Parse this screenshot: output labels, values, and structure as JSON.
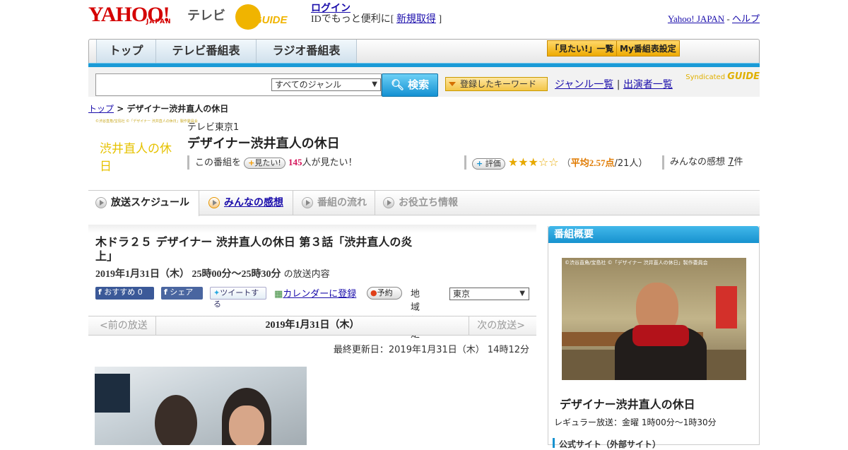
{
  "header": {
    "brand": "YAHOO!",
    "brand_sub": "JAPAN",
    "service": "テレビ",
    "gguide": "GUIDE",
    "login": "ログイン",
    "login_note": "IDでもっと便利に[",
    "signup": "新規取得",
    "login_note_end": "]",
    "yahoo_japan": "Yahoo! JAPAN",
    "sep": "-",
    "help": "ヘルプ"
  },
  "nav": {
    "tabs": [
      "トップ",
      "テレビ番組表",
      "ラジオ番組表"
    ],
    "watch_list": "「見たい!」一覧",
    "my_schedule": "My番組表設定"
  },
  "search": {
    "genre": "すべてのジャンル",
    "button": "検索",
    "keyword": "登録したキーワード",
    "genre_list": "ジャンル一覧",
    "divider": "|",
    "cast_list": "出演者一覧",
    "syndicated": "Syndicated"
  },
  "breadcrumb": {
    "top": "トップ",
    "sep": ">",
    "current": "デザイナー渋井直人の休日"
  },
  "program": {
    "thumb_small": "©渋谷直角/宝島社 ©「デザイナー 渋井直人の休日」製作委員会",
    "thumb_title": "渋井直人の休日",
    "channel": "テレビ東京1",
    "title": "デザイナー渋井直人の休日",
    "want_prefix": "この番組を",
    "want_button": "見たい!",
    "want_count": "145",
    "want_suffix": "人が見たい！",
    "rate_button": "評価",
    "stars": "★★★☆☆",
    "avg_open": "（",
    "avg": "平均2.57点",
    "avg_count": "/21人）",
    "review_label": "みんなの感想",
    "review_count": "7",
    "review_suffix": "件"
  },
  "subtabs": [
    "放送スケジュール",
    "みんなの感想",
    "番組の流れ",
    "お役立ち情報"
  ],
  "episode": {
    "title": "木ドラ２５ デザイナー 渋井直人の休日 第３話「渋井直人の炎上」",
    "datetime": "2019年1月31日（木） 25時00分～25時30分",
    "datetime_suffix": "の放送内容",
    "recommend": "おすすめ 0",
    "share": "シェア",
    "tweet": "ツイートする",
    "calendar": "カレンダーに登録",
    "reserve": "予約",
    "area_label": "地域設定",
    "area": "東京"
  },
  "pager": {
    "prev": "<前の放送",
    "current": "2019年1月31日（木）",
    "next": "次の放送>"
  },
  "updated": "最終更新日：2019年1月31日（木） 14時12分",
  "sidebar": {
    "header": "番組概要",
    "photo_caption": "©渋谷直角/宝島社 ©「デザイナー 渋井直人の休日」製作委員会",
    "title": "デザイナー渋井直人の休日",
    "regular": "レギュラー放送：金曜 1時00分～1時30分",
    "official": "公式サイト（外部サイト）"
  },
  "colors": {
    "brand_red": "#d40000",
    "accent_blue": "#1792cf",
    "gguide_yellow": "#f0b400",
    "rating_orange": "#e07a00",
    "want_pink": "#d4145a"
  }
}
